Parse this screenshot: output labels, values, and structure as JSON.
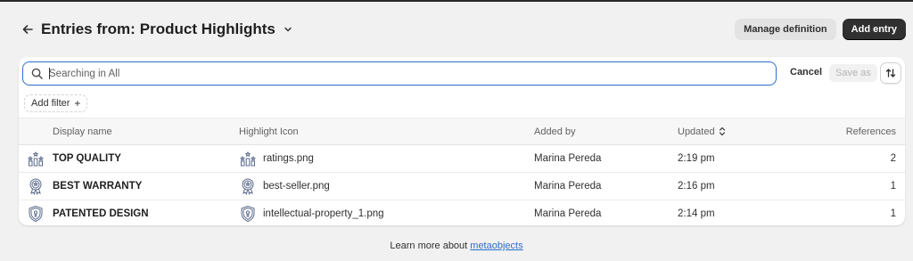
{
  "header": {
    "title_prefix": "Entries from:",
    "title_name": "Product Highlights",
    "manage_label": "Manage definition",
    "add_label": "Add entry"
  },
  "search": {
    "placeholder": "Searching in All",
    "cancel_label": "Cancel",
    "save_as_label": "Save as"
  },
  "filter": {
    "add_label": "Add filter",
    "plus": "+"
  },
  "table": {
    "columns": {
      "display_name": "Display name",
      "highlight_icon": "Highlight Icon",
      "added_by": "Added by",
      "updated": "Updated",
      "references": "References"
    },
    "rows": [
      {
        "name": "TOP QUALITY",
        "icon_name": "ratings-icon",
        "file": "ratings.png",
        "added_by": "Marina Pereda",
        "updated": "2:19 pm",
        "references": "2"
      },
      {
        "name": "BEST WARRANTY",
        "icon_name": "best-seller-icon",
        "file": "best-seller.png",
        "added_by": "Marina Pereda",
        "updated": "2:16 pm",
        "references": "1"
      },
      {
        "name": "PATENTED DESIGN",
        "icon_name": "shield-icon",
        "file": "intellectual-property_1.png",
        "added_by": "Marina Pereda",
        "updated": "2:14 pm",
        "references": "1"
      }
    ]
  },
  "footer": {
    "text": "Learn more about ",
    "link": "metaobjects"
  },
  "colors": {
    "accent": "#2c6ecb",
    "primary_button": "#303030",
    "icon_stroke": "#5b6b8c"
  }
}
